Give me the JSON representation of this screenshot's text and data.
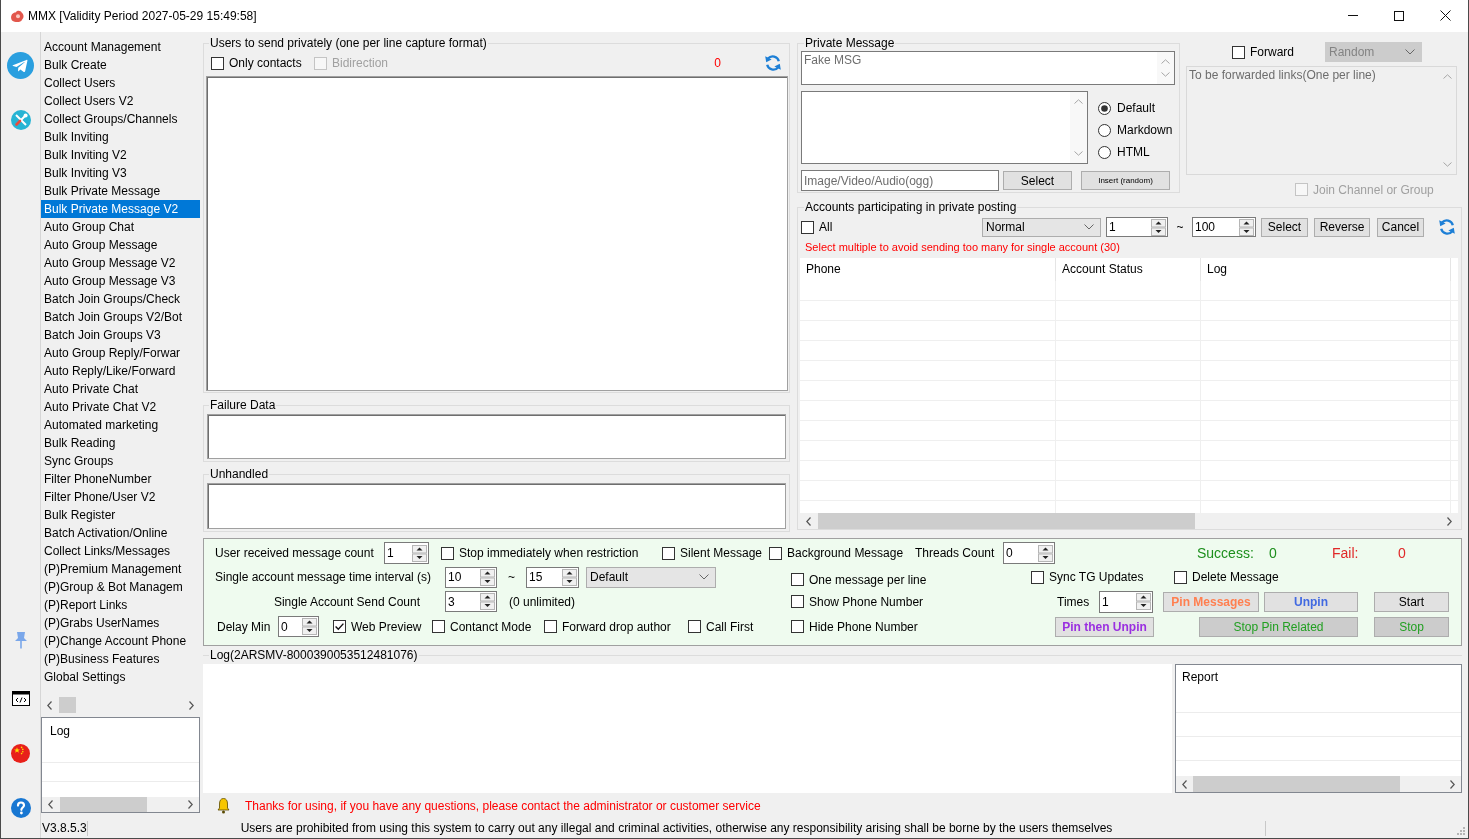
{
  "window": {
    "title": "MMX [Validity Period 2027-05-29 15:49:58]"
  },
  "sidebar": {
    "items": [
      {
        "label": "Account Management",
        "selected": false
      },
      {
        "label": "Bulk Create",
        "selected": false
      },
      {
        "label": "Collect Users",
        "selected": false
      },
      {
        "label": "Collect Users V2",
        "selected": false
      },
      {
        "label": "Collect Groups/Channels",
        "selected": false
      },
      {
        "label": "Bulk Inviting",
        "selected": false
      },
      {
        "label": "Bulk Inviting V2",
        "selected": false
      },
      {
        "label": "Bulk Inviting V3",
        "selected": false
      },
      {
        "label": "Bulk Private Message",
        "selected": false
      },
      {
        "label": "Bulk Private Message V2",
        "selected": true
      },
      {
        "label": "Auto Group Chat",
        "selected": false
      },
      {
        "label": "Auto Group Message",
        "selected": false
      },
      {
        "label": "Auto Group Message V2",
        "selected": false
      },
      {
        "label": "Auto Group Message V3",
        "selected": false
      },
      {
        "label": "Batch Join Groups/Check",
        "selected": false
      },
      {
        "label": "Batch Join Groups V2/Bot",
        "selected": false
      },
      {
        "label": "Batch Join Groups V3",
        "selected": false
      },
      {
        "label": "Auto Group Reply/Forwar",
        "selected": false
      },
      {
        "label": "Auto Reply/Like/Forward",
        "selected": false
      },
      {
        "label": "Auto Private Chat",
        "selected": false
      },
      {
        "label": "Auto Private Chat V2",
        "selected": false
      },
      {
        "label": "Automated marketing",
        "selected": false
      },
      {
        "label": "Bulk Reading",
        "selected": false
      },
      {
        "label": "Sync Groups",
        "selected": false
      },
      {
        "label": "Filter PhoneNumber",
        "selected": false
      },
      {
        "label": "Filter Phone/User V2",
        "selected": false
      },
      {
        "label": "Bulk Register",
        "selected": false
      },
      {
        "label": "Batch Activation/Online",
        "selected": false
      },
      {
        "label": "Collect Links/Messages",
        "selected": false
      },
      {
        "label": "(P)Premium Management",
        "selected": false
      },
      {
        "label": "(P)Group & Bot Managem",
        "selected": false
      },
      {
        "label": "(P)Report Links",
        "selected": false
      },
      {
        "label": "(P)Grabs UserNames",
        "selected": false
      },
      {
        "label": "(P)Change Account Phone",
        "selected": false
      },
      {
        "label": "(P)Business Features",
        "selected": false
      },
      {
        "label": "Global Settings",
        "selected": false
      }
    ],
    "log": {
      "columns": [
        "Log"
      ]
    }
  },
  "recipients": {
    "title": "Users to send privately (one per line capture format)",
    "only_contacts": {
      "label": "Only contacts",
      "checked": false
    },
    "bidirection": {
      "label": "Bidirection",
      "checked": false,
      "disabled": true
    },
    "count": "0"
  },
  "failure_data": {
    "title": "Failure Data"
  },
  "unhandled": {
    "title": "Unhandled"
  },
  "private_message": {
    "title": "Private Message",
    "fake_message": {
      "placeholder": "Fake MSG"
    },
    "format_options": [
      {
        "label": "Default",
        "selected": true
      },
      {
        "label": "Markdown",
        "selected": false
      },
      {
        "label": "HTML",
        "selected": false
      }
    ],
    "media": {
      "placeholder": "Image/Video/Audio(ogg)"
    },
    "select_button": "Select",
    "insert_button": "Insert (random)"
  },
  "forward": {
    "label": "Forward",
    "checked": false,
    "mode": {
      "value": "Random",
      "disabled": true
    },
    "links": {
      "placeholder": "To be forwarded links(One per line)",
      "disabled": true
    },
    "join_channel": {
      "label": "Join Channel or Group",
      "checked": false,
      "disabled": true
    }
  },
  "accounts": {
    "title": "Accounts participating in private posting",
    "all": {
      "label": "All",
      "checked": false
    },
    "status_filter": "Normal",
    "range_from": "1",
    "range_separator": "~",
    "range_to": "100",
    "buttons": [
      "Select",
      "Reverse",
      "Cancel"
    ],
    "hint": "Select multiple to avoid sending too many for single account (30)",
    "table": {
      "columns": [
        "Phone",
        "Account Status",
        "Log"
      ]
    }
  },
  "settings": {
    "received_count": {
      "label": "User received message count",
      "value": "1"
    },
    "stop_on_restriction": {
      "label": "Stop immediately when restriction",
      "checked": false
    },
    "silent_message": {
      "label": "Silent Message",
      "checked": false
    },
    "background_message": {
      "label": "Background Message",
      "checked": false
    },
    "threads_count": {
      "label": "Threads Count",
      "value": "0"
    },
    "success": {
      "label": "Success:",
      "value": "0"
    },
    "fail": {
      "label": "Fail:",
      "value": "0"
    },
    "interval": {
      "label": "Single account message time interval (s)",
      "from": "10",
      "separator": "~",
      "to": "15",
      "mode": "Default"
    },
    "one_message_per_line": {
      "label": "One message per line",
      "checked": false
    },
    "sync_tg_updates": {
      "label": "Sync TG Updates",
      "checked": false
    },
    "delete_message": {
      "label": "Delete Message",
      "checked": false
    },
    "send_count": {
      "label": "Single Account Send Count",
      "value": "3",
      "note": "(0 unlimited)"
    },
    "show_phone_number": {
      "label": "Show Phone Number",
      "checked": false
    },
    "times": {
      "label": "Times",
      "value": "1"
    },
    "pin_messages": "Pin Messages",
    "unpin": "Unpin",
    "start": "Start",
    "delay_min": {
      "label": "Delay Min",
      "value": "0"
    },
    "web_preview": {
      "label": "Web Preview",
      "checked": true
    },
    "contact_mode": {
      "label": "Contanct Mode",
      "checked": false
    },
    "forward_drop_author": {
      "label": "Forward drop author",
      "checked": false
    },
    "call_first": {
      "label": "Call First",
      "checked": false
    },
    "hide_phone_number": {
      "label": "Hide Phone Number",
      "checked": false
    },
    "pin_then_unpin": "Pin then Unpin",
    "stop_pin_related": "Stop Pin Related",
    "stop": "Stop"
  },
  "log": {
    "title": "Log(2ARSMV-8000390053512481076)",
    "report": {
      "columns": [
        "Report"
      ]
    }
  },
  "notice": "Thanks for using, if you have any questions, please contact the administrator or customer service",
  "status_bar": {
    "version": "V3.8.5.3",
    "message": "Users are prohibited from using this system to carry out any illegal and criminal activities, otherwise any responsibility arising shall be borne by the users themselves"
  }
}
